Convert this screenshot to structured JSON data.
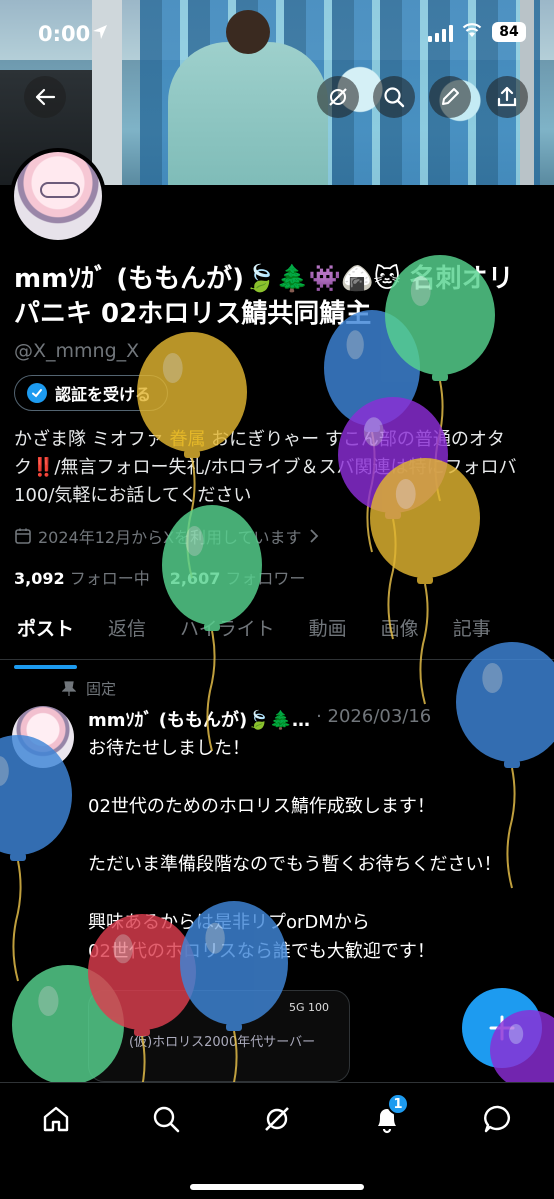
{
  "status_bar": {
    "time": "0:00",
    "battery": "84"
  },
  "profile": {
    "name": "mmｿｶﾞ (ももんが)🍃🌲👾🍙🐱 名刺オリパニキ 02ホロリス鯖共同鯖主",
    "handle": "@X_mmng_X",
    "verify_label": "認証を受ける",
    "bio_before": "かざま隊 ミオファ ",
    "bio_highlight": "眷属",
    "bio_after": " おにぎりゃー すこん部の普通のオタク‼️/無言フォロー失礼/ホロライブ＆スバ関連は特にフォロバ100/気軽にお話してください",
    "joined": "2024年12月からXを利用しています",
    "following_count": "3,092",
    "following_label": "フォロー中",
    "followers_count": "2,607",
    "followers_label": "フォロワー"
  },
  "tabs": [
    {
      "label": "ポスト"
    },
    {
      "label": "返信"
    },
    {
      "label": "ハイライト"
    },
    {
      "label": "動画"
    },
    {
      "label": "画像"
    },
    {
      "label": "記事"
    }
  ],
  "post": {
    "pinned_label": "固定",
    "author": "mmｿｶﾞ (ももんが)🍃🌲…",
    "date": "· 2026/03/16",
    "lines": [
      "お待たせしました！",
      "",
      "02世代のためのホロリス鯖作成致します！",
      "",
      "ただいま準備段階なのでもう暫くお待ちください！",
      "",
      "興味あるからは是非リプorDMから",
      "02世代のホロリスなら誰でも大歓迎です！"
    ],
    "image_caption": "(仮)ホロリス2000年代サーバー",
    "image_status": "5G 100"
  },
  "bottom_nav": {
    "notification_count": "1"
  },
  "colors": {
    "accent": "#1d9bf0",
    "background": "#000000",
    "muted": "#71767b",
    "highlight": "#f5c400"
  },
  "balloons": [
    {
      "color": "#3f86d8"
    },
    {
      "color": "#57d38f"
    },
    {
      "color": "#e1b531"
    },
    {
      "color": "#8b2ed6"
    },
    {
      "color": "#e1b531"
    },
    {
      "color": "#57d38f"
    },
    {
      "color": "#3f86d8"
    },
    {
      "color": "#3f86d8"
    },
    {
      "color": "#57d38f"
    },
    {
      "color": "#dc3e4f"
    },
    {
      "color": "#3f86d8"
    },
    {
      "color": "#8b2ed6"
    }
  ]
}
